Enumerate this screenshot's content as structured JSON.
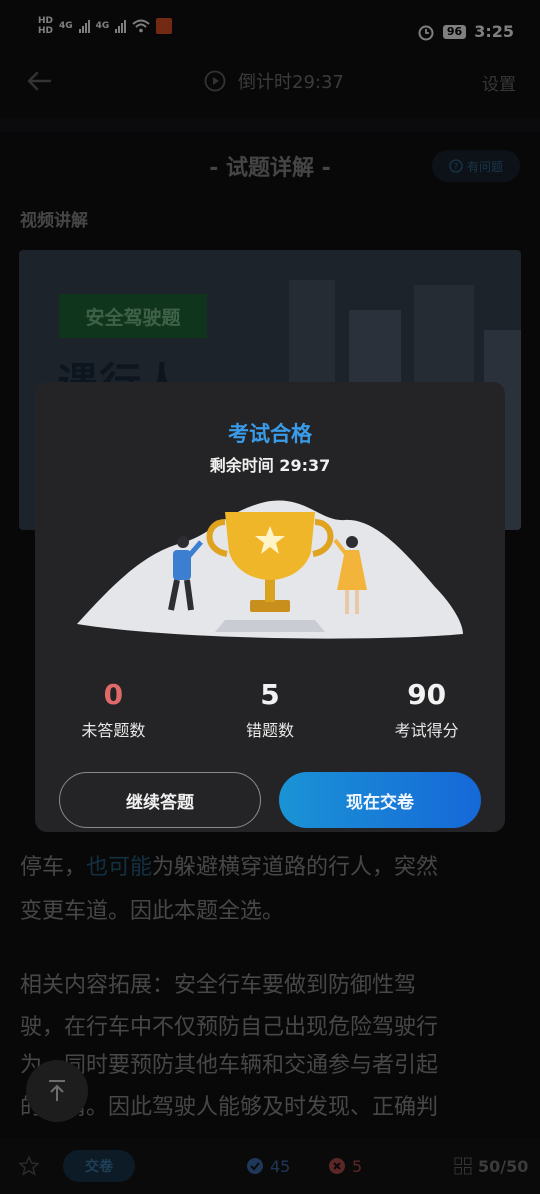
{
  "status_bar": {
    "network_1": "HD",
    "network_2": "HD",
    "signal_1": "4G",
    "signal_2": "4G",
    "battery": "96",
    "time": "3:25"
  },
  "nav": {
    "timer_label": "倒计时29:37",
    "settings_label": "设置"
  },
  "section": {
    "title": "- 试题详解 -",
    "issue_label": "有问题",
    "video_label": "视频讲解"
  },
  "video": {
    "tag": "安全驾驶题",
    "headline": "遇行人"
  },
  "explanation": {
    "line_1_end": "停车，",
    "line_1_highlight": "也可能",
    "line_1_rest": "为躲避横穿道路的行人，突然",
    "line_2": "变更车道。因此本题全选。",
    "line_3": "相关内容拓展：安全行车要做到防御性驾",
    "line_4": "驶，在行车中不仅预防自己出现危险驾驶行",
    "line_5": "为，同时要预防其他车辆和交通参与者引起",
    "line_6": "的事情。因此驾驶人能够及时发现、正确判"
  },
  "dialog": {
    "title": "考试合格",
    "remaining_time": "剩余时间 29:37",
    "stats": [
      {
        "value": "0",
        "label": "未答题数"
      },
      {
        "value": "5",
        "label": "错题数"
      },
      {
        "value": "90",
        "label": "考试得分"
      }
    ],
    "continue_label": "继续答题",
    "submit_label": "现在交卷"
  },
  "bottom_bar": {
    "submit_label": "交卷",
    "correct_count": "45",
    "wrong_count": "5",
    "progress": "50/50"
  },
  "colors": {
    "accent": "#3a9be8",
    "submit_gradient_start": "#1a93d5",
    "submit_gradient_end": "#1668d8",
    "unanswered": "#e06a6a"
  }
}
